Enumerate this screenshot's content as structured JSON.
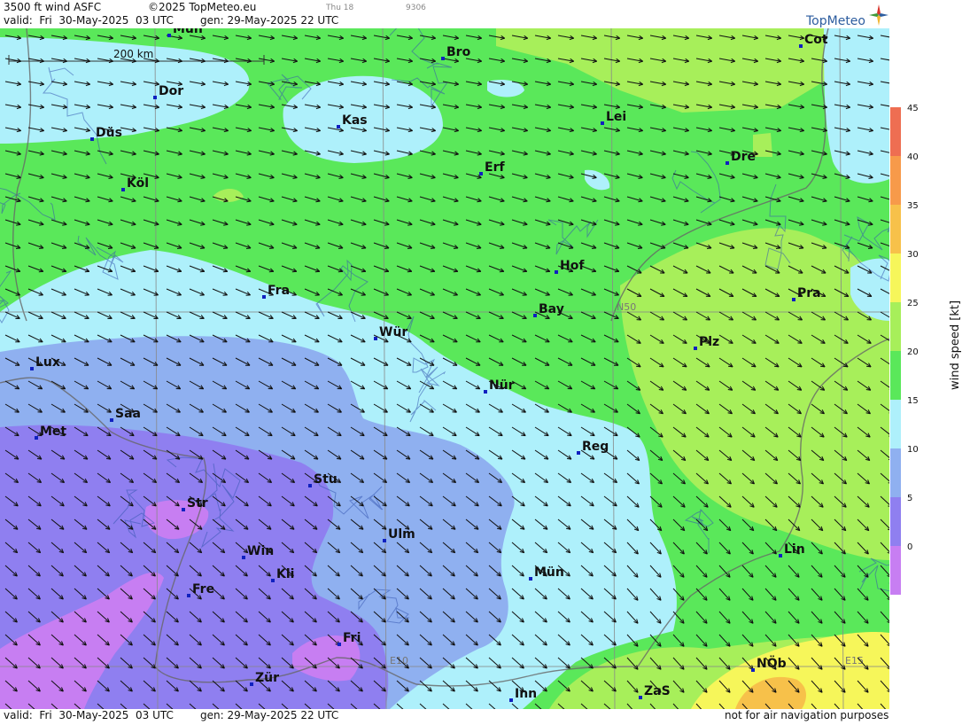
{
  "header": {
    "title": "3500 ft wind ASFC",
    "copyright": "©2025 TopMeteo.eu",
    "day_label": "Thu 18",
    "code": "9306",
    "valid": "valid:  Fri  30-May-2025  03 UTC",
    "gen": "gen: 29-May-2025 22 UTC"
  },
  "logo": {
    "text": "TopMeteo",
    "icon": "compass-star-icon"
  },
  "footer": {
    "valid": "valid:  Fri  30-May-2025  03 UTC",
    "gen": "gen: 29-May-2025 22 UTC",
    "disclaimer": "not for air navigation purposes"
  },
  "map": {
    "scale_label": "200 km",
    "grid_labels": {
      "lat": "N50",
      "lon1": "E10",
      "lon2": "E15"
    },
    "cities": [
      {
        "name": "Mün",
        "id": "mun-north"
      },
      {
        "name": "Bro"
      },
      {
        "name": "Cot"
      },
      {
        "name": "Dor"
      },
      {
        "name": "Kas"
      },
      {
        "name": "Düs"
      },
      {
        "name": "Lei"
      },
      {
        "name": "Erf"
      },
      {
        "name": "Dre"
      },
      {
        "name": "Köl"
      },
      {
        "name": "Hof"
      },
      {
        "name": "Fra"
      },
      {
        "name": "Pra"
      },
      {
        "name": "Bay"
      },
      {
        "name": "Wür"
      },
      {
        "name": "Plz"
      },
      {
        "name": "Lux"
      },
      {
        "name": "Nür"
      },
      {
        "name": "Saa"
      },
      {
        "name": "Met"
      },
      {
        "name": "Reg"
      },
      {
        "name": "Stu"
      },
      {
        "name": "Str"
      },
      {
        "name": "Ulm"
      },
      {
        "name": "Lin"
      },
      {
        "name": "Win"
      },
      {
        "name": "Kli"
      },
      {
        "name": "Mün"
      },
      {
        "name": "Fre"
      },
      {
        "name": "Fri"
      },
      {
        "name": "NÖb"
      },
      {
        "name": "Zür"
      },
      {
        "name": "Inn"
      },
      {
        "name": "ZaS"
      }
    ]
  },
  "legend": {
    "title": "wind speed [kt]",
    "ticks": [
      "0",
      "5",
      "10",
      "15",
      "20",
      "25",
      "30",
      "35",
      "40",
      "45"
    ],
    "colors": [
      "#c77ef2",
      "#8f7ff0",
      "#8fb0f0",
      "#aef0fb",
      "#5ae85a",
      "#a7ef5a",
      "#f6f65a",
      "#f7c14a",
      "#f79a4a",
      "#ee6e52"
    ]
  }
}
